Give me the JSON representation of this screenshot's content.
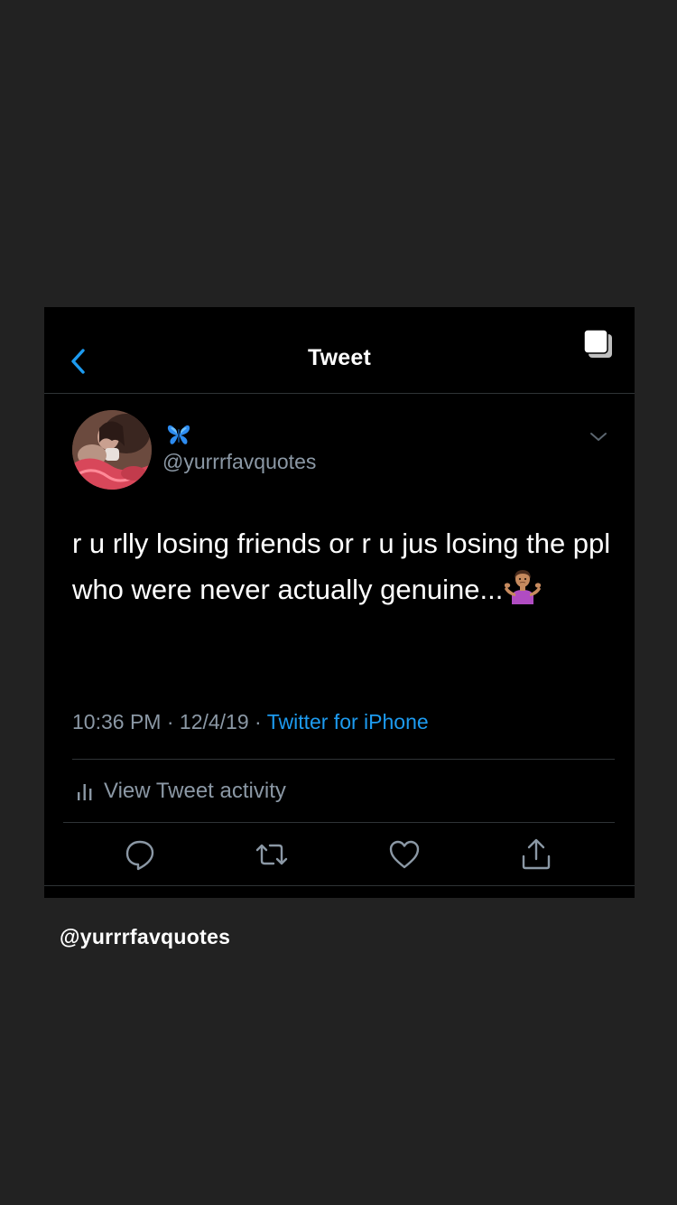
{
  "header": {
    "title": "Tweet",
    "back_icon": "chevron-left-icon",
    "layers_icon": "layers-icon"
  },
  "tweet": {
    "author_badge_icon": "butterfly-emoji",
    "handle": "@yurrrfavquotes",
    "text": "r u rlly losing friends or r u jus losing the ppl who were never actually genuine...",
    "emoji": "person-shrugging-emoji",
    "time": "10:36 PM",
    "date": "12/4/19",
    "separator": " · ",
    "source": "Twitter for iPhone"
  },
  "activity": {
    "icon": "bar-chart-icon",
    "label": "View Tweet activity"
  },
  "actions": [
    "reply-icon",
    "retweet-icon",
    "like-icon",
    "share-icon"
  ],
  "footer": {
    "handle": "@yurrrfavquotes"
  },
  "colors": {
    "background": "#222222",
    "card": "#000000",
    "accent": "#1d9bf0",
    "muted": "#8b98a5",
    "divider": "#2f3336"
  }
}
